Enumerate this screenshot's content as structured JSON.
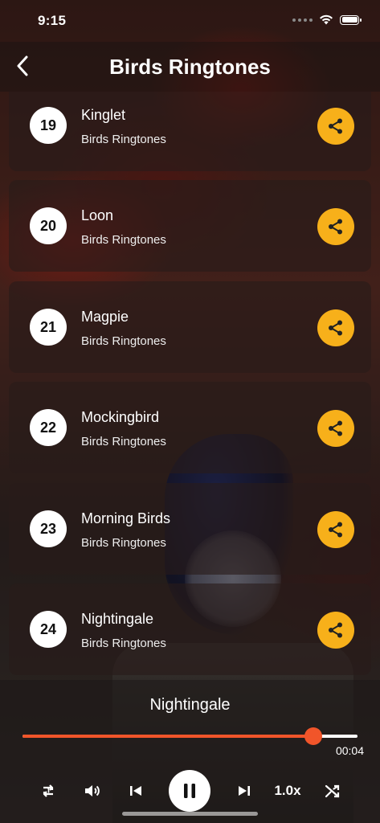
{
  "status_bar": {
    "time": "9:15"
  },
  "header": {
    "title": "Birds Ringtones"
  },
  "ringtones": [
    {
      "number": "19",
      "name": "Kinglet",
      "category": "Birds Ringtones"
    },
    {
      "number": "20",
      "name": "Loon",
      "category": "Birds Ringtones"
    },
    {
      "number": "21",
      "name": "Magpie",
      "category": "Birds Ringtones"
    },
    {
      "number": "22",
      "name": "Mockingbird",
      "category": "Birds Ringtones"
    },
    {
      "number": "23",
      "name": "Morning Birds",
      "category": "Birds Ringtones"
    },
    {
      "number": "24",
      "name": "Nightingale",
      "category": "Birds Ringtones"
    }
  ],
  "player": {
    "track_name": "Nightingale",
    "progress_fraction": 0.869,
    "duration": "00:04",
    "speed_label": "1.0x",
    "state": "playing"
  },
  "colors": {
    "accent": "#f1552a",
    "share_button": "#f7b01a",
    "card_bg": "rgba(40,28,26,0.62)"
  },
  "icons": {
    "back": "chevron-left-icon",
    "share": "share-icon",
    "repeat": "repeat-one-icon",
    "volume": "volume-icon",
    "previous": "skip-previous-icon",
    "pause": "pause-icon",
    "next": "skip-next-icon",
    "shuffle": "shuffle-icon"
  }
}
